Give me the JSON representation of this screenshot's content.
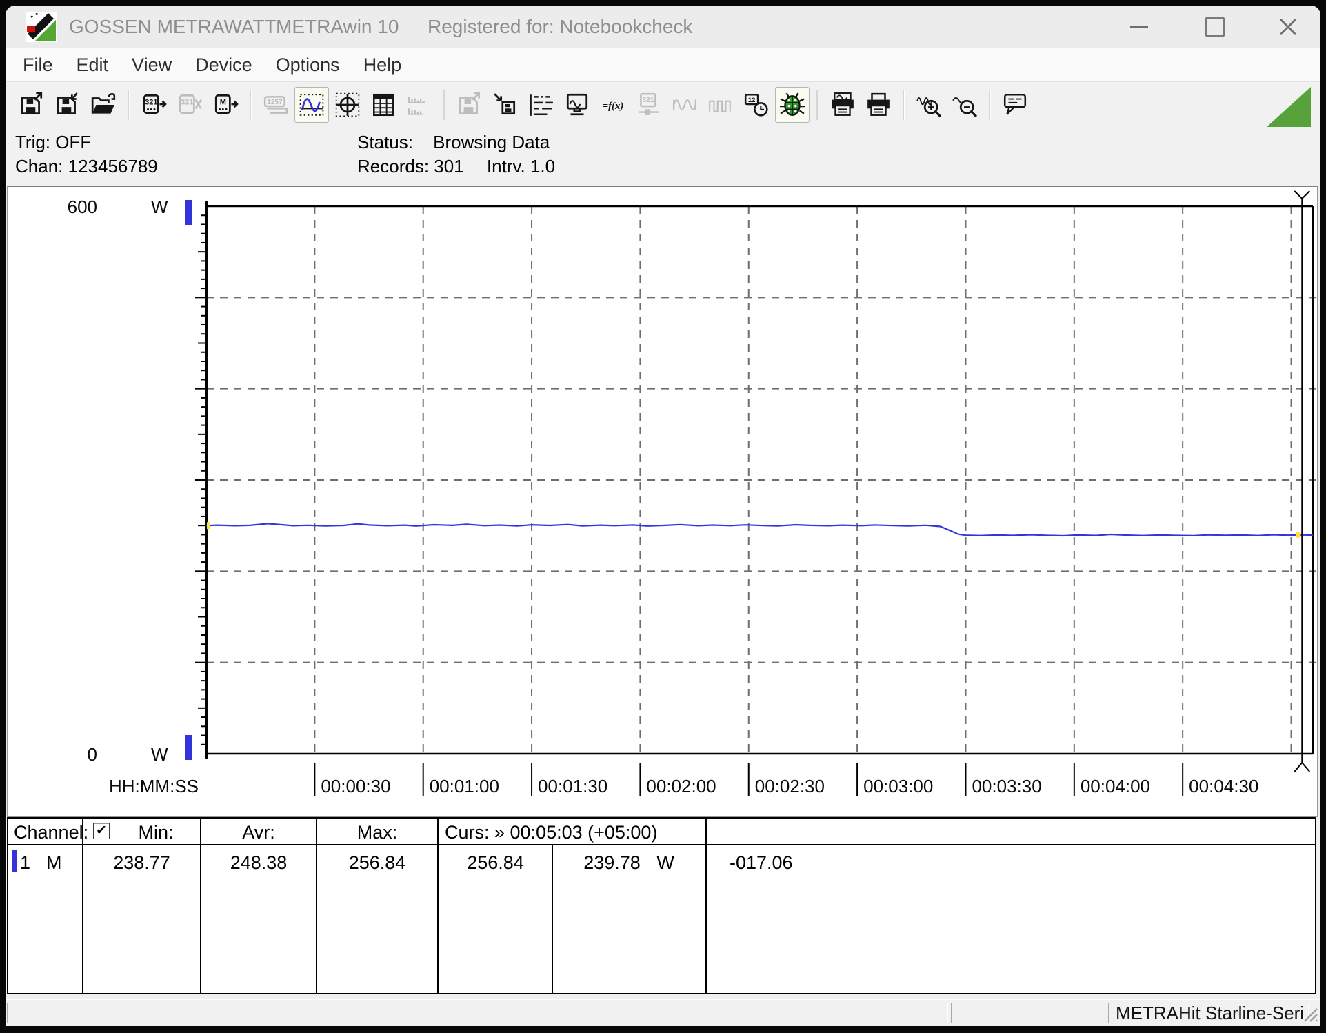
{
  "window": {
    "title_brand": "GOSSEN METRAWATT",
    "title_app": "METRAwin 10",
    "title_registered": "Registered for: Notebookcheck"
  },
  "menu": {
    "items": [
      "File",
      "Edit",
      "View",
      "Device",
      "Options",
      "Help"
    ]
  },
  "toolbar": {
    "groups": [
      [
        {
          "name": "save-file-button",
          "glyph": "floppy-out"
        },
        {
          "name": "save-as-button",
          "glyph": "floppy-in"
        },
        {
          "name": "open-file-button",
          "glyph": "folder-open"
        }
      ],
      [
        {
          "name": "read-device-button",
          "glyph": "device-arrow",
          "text": "321"
        },
        {
          "name": "disconnect-device-button",
          "glyph": "device-cut",
          "text": "321",
          "state": "disabled"
        },
        {
          "name": "read-memory-button",
          "glyph": "device-arrow",
          "text": "M"
        }
      ],
      [
        {
          "name": "numeric-display-button",
          "glyph": "display",
          "text": "1257",
          "state": "disabled"
        },
        {
          "name": "chart-view-button",
          "glyph": "chart",
          "state": "pressed"
        },
        {
          "name": "crosshair-view-button",
          "glyph": "crosshair"
        },
        {
          "name": "table-view-button",
          "glyph": "table"
        },
        {
          "name": "histogram-view-button",
          "glyph": "histogram",
          "state": "disabled"
        }
      ],
      [
        {
          "name": "export-data-button",
          "glyph": "floppy-out",
          "state": "disabled"
        },
        {
          "name": "import-data-button",
          "glyph": "import"
        },
        {
          "name": "channel-settings-button",
          "glyph": "channels"
        },
        {
          "name": "live-monitor-button",
          "glyph": "monitor"
        },
        {
          "name": "formula-button",
          "glyph": "fx",
          "text": "=f(x)"
        },
        {
          "name": "device-settings-button",
          "glyph": "device-config",
          "text": "321",
          "state": "disabled"
        },
        {
          "name": "analog-wave-button",
          "glyph": "sine",
          "state": "disabled"
        },
        {
          "name": "pulse-wave-button",
          "glyph": "pulse",
          "state": "disabled"
        },
        {
          "name": "datetime-button",
          "glyph": "clock",
          "text": "12"
        },
        {
          "name": "debug-bug-button",
          "glyph": "bug",
          "state": "pressed"
        }
      ],
      [
        {
          "name": "print-preview-button",
          "glyph": "print-preview"
        },
        {
          "name": "print-button",
          "glyph": "printer"
        }
      ],
      [
        {
          "name": "zoom-in-button",
          "glyph": "zoom-in"
        },
        {
          "name": "zoom-out-button",
          "glyph": "zoom-out"
        }
      ],
      [
        {
          "name": "hint-button",
          "glyph": "balloon"
        }
      ]
    ]
  },
  "info": {
    "trig": "Trig: OFF",
    "chan": "Chan: 123456789",
    "status_label": "Status:",
    "status_value": "Browsing Data",
    "records": "Records: 301",
    "interval": "Intrv. 1.0"
  },
  "chart_data": {
    "type": "line",
    "title": "",
    "xlabel": "HH:MM:SS",
    "ylabel": "W",
    "ylim": [
      0,
      600
    ],
    "grid": true,
    "legend": "none",
    "y_gridlines": [
      100,
      200,
      300,
      400,
      500
    ],
    "x_range_seconds": [
      0,
      306
    ],
    "x_gridline_seconds": [
      30,
      60,
      90,
      120,
      150,
      180,
      210,
      240,
      270,
      300
    ],
    "x_tick_seconds": [
      30,
      60,
      90,
      120,
      150,
      180,
      210,
      240,
      270
    ],
    "x_ticks": [
      "00:00:30",
      "00:01:00",
      "00:01:30",
      "00:02:00",
      "00:02:30",
      "00:03:00",
      "00:03:30",
      "00:04:00",
      "00:04:30"
    ],
    "axis_labels": {
      "y_top": "600",
      "y_bottom": "0",
      "y_unit": "W",
      "x_label": "HH:MM:SS"
    },
    "cursor": {
      "time": "00:05:03",
      "offset": "(+05:00)",
      "seconds": 303,
      "value_W": 239.78,
      "delta": "-017.06"
    },
    "stats": {
      "min": 238.77,
      "avg": 248.38,
      "max": 256.84,
      "unit": "W"
    },
    "series": [
      {
        "name": "Channel 1 (M) power",
        "color": "#3434dd",
        "points": [
          [
            0,
            249.9
          ],
          [
            3,
            250.4
          ],
          [
            8,
            249.8
          ],
          [
            12,
            250.2
          ],
          [
            17,
            252.1
          ],
          [
            20,
            251.2
          ],
          [
            24,
            249.8
          ],
          [
            28,
            250.3
          ],
          [
            33,
            249.7
          ],
          [
            38,
            250.1
          ],
          [
            42,
            251.9
          ],
          [
            45,
            250.6
          ],
          [
            50,
            249.8
          ],
          [
            55,
            250.4
          ],
          [
            58,
            249.5
          ],
          [
            63,
            250.9
          ],
          [
            68,
            250.2
          ],
          [
            72,
            251.3
          ],
          [
            77,
            249.9
          ],
          [
            81,
            250.5
          ],
          [
            86,
            249.6
          ],
          [
            90,
            250.8
          ],
          [
            95,
            250.1
          ],
          [
            100,
            251.1
          ],
          [
            104,
            249.7
          ],
          [
            109,
            250.4
          ],
          [
            113,
            249.9
          ],
          [
            118,
            250.6
          ],
          [
            122,
            249.5
          ],
          [
            127,
            250.2
          ],
          [
            131,
            251.0
          ],
          [
            136,
            249.8
          ],
          [
            140,
            250.5
          ],
          [
            145,
            249.9
          ],
          [
            149,
            250.7
          ],
          [
            154,
            250.0
          ],
          [
            158,
            249.6
          ],
          [
            163,
            250.9
          ],
          [
            167,
            250.2
          ],
          [
            172,
            249.8
          ],
          [
            176,
            250.4
          ],
          [
            181,
            249.9
          ],
          [
            185,
            250.6
          ],
          [
            190,
            250.0
          ],
          [
            194,
            249.7
          ],
          [
            199,
            250.3
          ],
          [
            203,
            249.0
          ],
          [
            206,
            244.0
          ],
          [
            208,
            240.5
          ],
          [
            210,
            239.4
          ],
          [
            214,
            239.0
          ],
          [
            219,
            239.7
          ],
          [
            223,
            239.2
          ],
          [
            228,
            239.9
          ],
          [
            232,
            239.3
          ],
          [
            237,
            238.8
          ],
          [
            241,
            239.6
          ],
          [
            246,
            239.1
          ],
          [
            250,
            240.3
          ],
          [
            255,
            239.5
          ],
          [
            259,
            239.0
          ],
          [
            264,
            239.7
          ],
          [
            268,
            239.2
          ],
          [
            273,
            238.9
          ],
          [
            277,
            239.8
          ],
          [
            282,
            239.3
          ],
          [
            286,
            239.6
          ],
          [
            291,
            239.0
          ],
          [
            295,
            239.9
          ],
          [
            299,
            239.4
          ],
          [
            303,
            239.78
          ],
          [
            306,
            239.5
          ]
        ]
      }
    ]
  },
  "table": {
    "headers": {
      "channel": "Channel:",
      "min": "Min:",
      "avr": "Avr:",
      "max": "Max:",
      "curs": "Curs: » 00:05:03 (+05:00)"
    },
    "checkbox_glyph": "✔",
    "row": {
      "num": "1",
      "mode": "M",
      "min": "238.77",
      "avr": "248.38",
      "max": "256.84",
      "curs_at": "256.84",
      "curs_value": "239.78",
      "curs_unit": "W",
      "curs_delta": "-017.06",
      "color": "#3434dd"
    }
  },
  "statusbar": {
    "device": "METRAHit Starline-Seri"
  },
  "colors": {
    "accent_blue": "#3434dd",
    "bug_green": "#2f9e2f",
    "logo_green": "#53a733",
    "logo_red": "#cc1111"
  }
}
